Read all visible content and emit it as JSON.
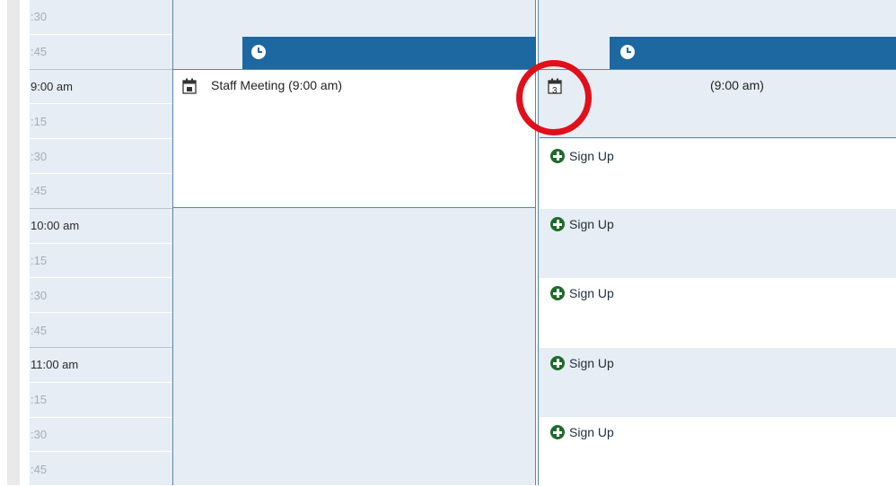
{
  "time_slots": [
    ":30",
    ":45",
    "9:00 am",
    ":15",
    ":30",
    ":45",
    "10:00 am",
    ":15",
    ":30",
    ":45",
    "11:00 am",
    ":15",
    ":30",
    ":45"
  ],
  "day1": {
    "event_title": "Staff Meeting (9:00 am)",
    "event_icon": "calendar-event-icon"
  },
  "day2": {
    "event_title": "(9:00 am)",
    "event_icon_day": "3",
    "signup_label": "Sign Up",
    "signups": [
      "Sign Up",
      "Sign Up",
      "Sign Up",
      "Sign Up",
      "Sign Up"
    ]
  },
  "colors": {
    "header_bar": "#1d68a0",
    "grid_bg": "#e6edf4",
    "border": "#5b86a8",
    "signup_icon": "#1e6b2b",
    "highlight_ring": "#e0101a"
  },
  "icons": {
    "header_clock": "clock-icon",
    "signup": "plus-circle-icon"
  }
}
